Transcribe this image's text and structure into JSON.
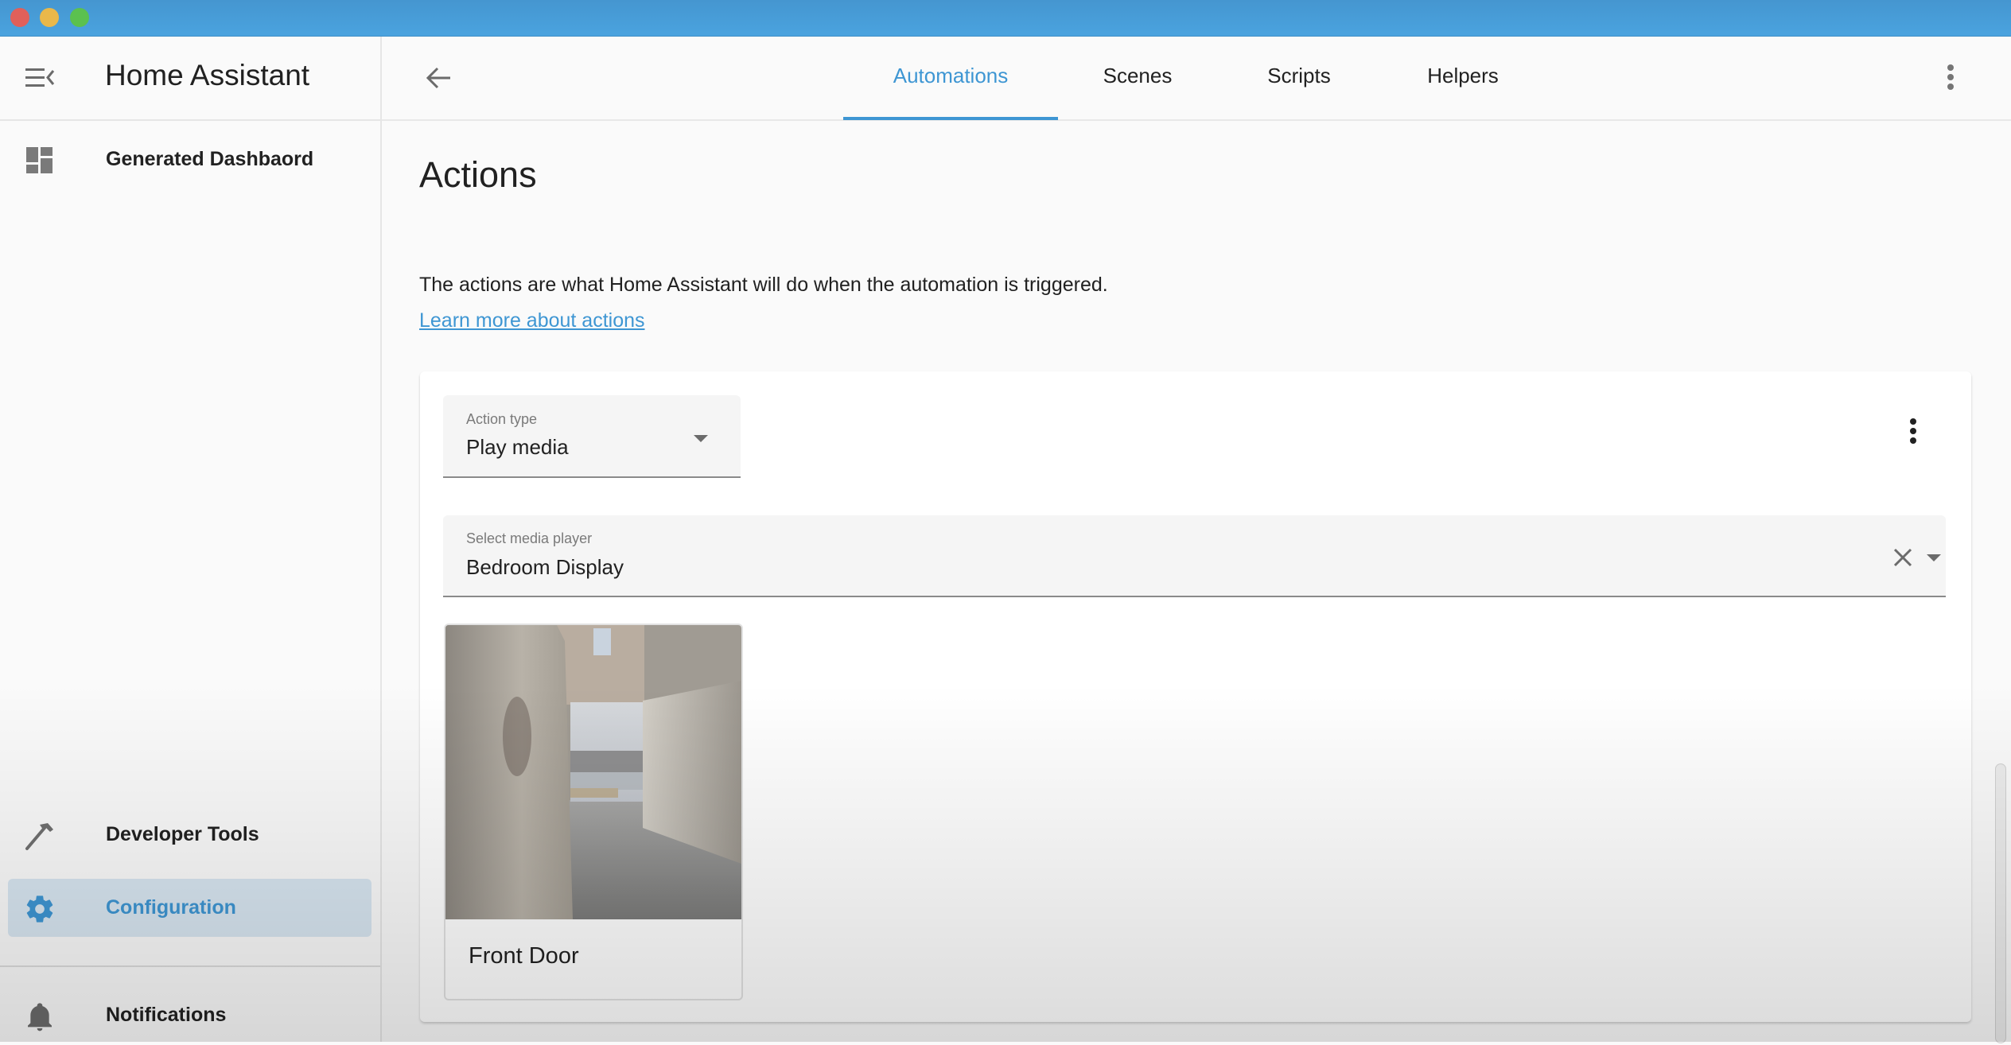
{
  "window": {
    "controls": [
      "close",
      "minimize",
      "maximize"
    ]
  },
  "sidebar": {
    "app_title": "Home Assistant",
    "menu_icon": "menu-collapse-icon",
    "items": [
      {
        "label": "Generated Dashbaord",
        "icon": "dashboard-icon",
        "active": false
      },
      {
        "label": "Developer Tools",
        "icon": "hammer-icon",
        "active": false
      },
      {
        "label": "Configuration",
        "icon": "gear-icon",
        "active": true
      },
      {
        "label": "Notifications",
        "icon": "bell-icon",
        "active": false
      }
    ]
  },
  "header": {
    "back_icon": "arrow-left-icon",
    "tabs": [
      {
        "label": "Automations",
        "active": true
      },
      {
        "label": "Scenes",
        "active": false
      },
      {
        "label": "Scripts",
        "active": false
      },
      {
        "label": "Helpers",
        "active": false
      }
    ],
    "overflow_icon": "kebab-menu-icon"
  },
  "main": {
    "title": "Actions",
    "description": "The actions are what Home Assistant will do when the automation is triggered.",
    "learn_more_link": "Learn more about actions",
    "action_card": {
      "action_type": {
        "label": "Action type",
        "value": "Play media"
      },
      "media_player": {
        "label": "Select media player",
        "value": "Bedroom Display"
      },
      "media_items": [
        {
          "name": "Front Door",
          "kind": "camera-snapshot"
        }
      ]
    }
  },
  "colors": {
    "accent": "#3e96d3",
    "titlebar": "#4aa3df",
    "active_item_bg": "#d8e6f1",
    "text": "#212121"
  }
}
